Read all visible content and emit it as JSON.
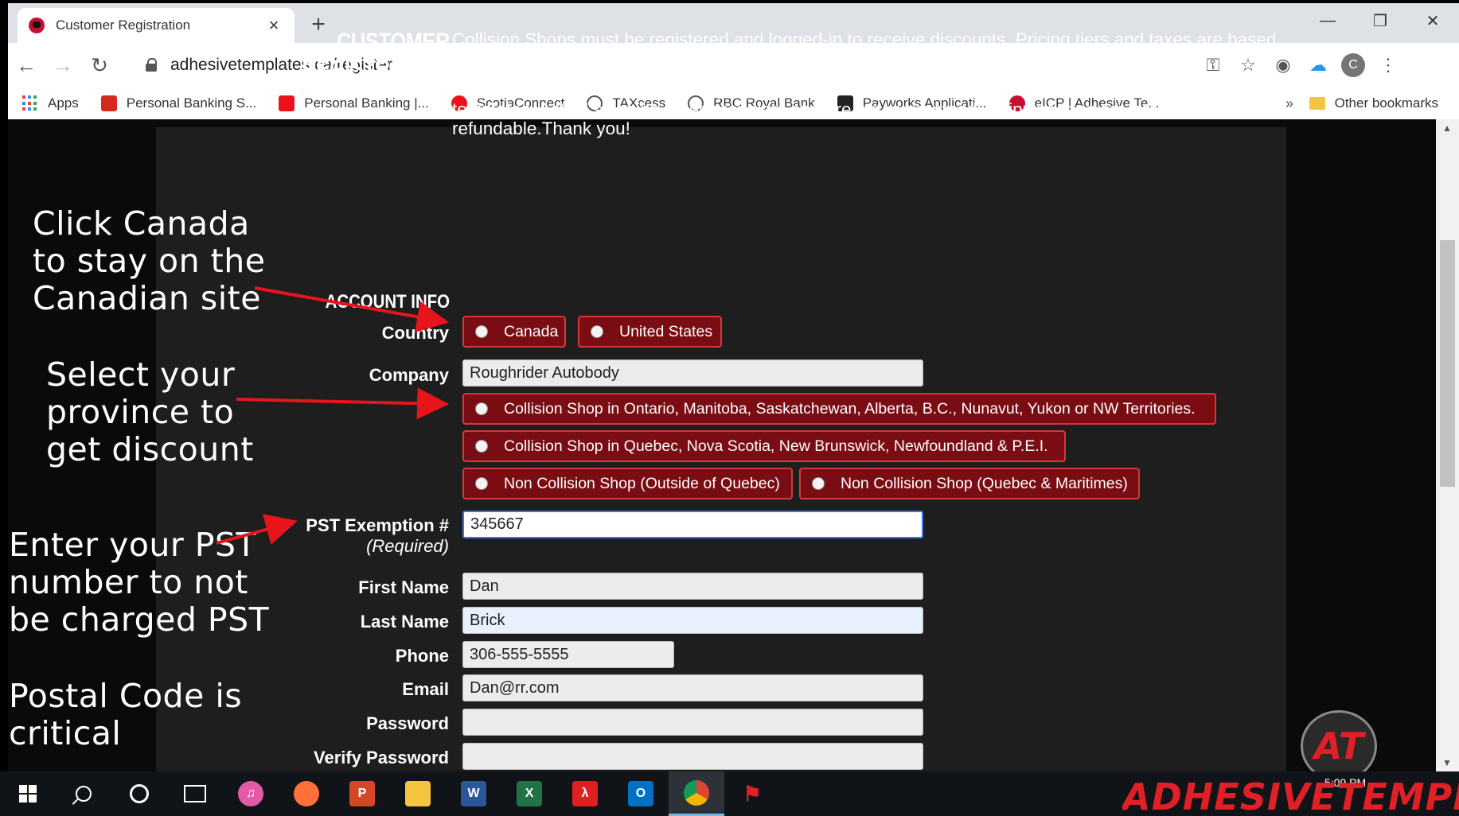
{
  "browser": {
    "tab_title": "Customer Registration",
    "tab_close": "×",
    "new_tab": "+",
    "url": "adhesivetemplates.ca/register",
    "bookmarks": [
      {
        "label": "Apps",
        "icon": "apps-grid-icon"
      },
      {
        "label": "Personal Banking S...",
        "icon": "canada-flag-icon",
        "color": "#d52b1e"
      },
      {
        "label": "Personal Banking |...",
        "icon": "scotiabank-icon",
        "color": "#ec111a"
      },
      {
        "label": "ScotiaConnect",
        "icon": "scotiabank-s-icon",
        "color": "#ec111a"
      },
      {
        "label": "TAXcess",
        "icon": "globe-icon",
        "color": "#555555"
      },
      {
        "label": "RBC Royal Bank",
        "icon": "globe-icon",
        "color": "#555555"
      },
      {
        "label": "Payworks Applicati...",
        "icon": "payworks-icon",
        "color": "#222222"
      },
      {
        "label": "eICP | Adhesive Te...",
        "icon": "adhesive-templates-icon",
        "color": "#c8102e"
      }
    ],
    "more_bookmarks": "»",
    "other_bookmarks": "Other bookmarks",
    "profile_initial": "C"
  },
  "page": {
    "title": "CUSTOMER REGISTRATION",
    "intro_1": "Collision Shops must be registered and logged-in to receive discounts. Pricing tiers and taxes are based on province. Please double-check your email address and province for accuracy.",
    "intro_2": "Supply items will be charged shipping costs based on weight. Express shipping options apply only to templates.  Actual shipping times may vary and are not guaranteed.  Shipping fees are not refundable.Thank you!",
    "section_account": "ACCOUNT INFO",
    "labels": {
      "country": "Country",
      "company": "Company",
      "pst": "PST Exemption #",
      "pst_required": "(Required)",
      "first_name": "First Name",
      "last_name": "Last Name",
      "phone": "Phone",
      "email": "Email",
      "password": "Password",
      "verify_password": "Verify Password"
    },
    "country_options": [
      "Canada",
      "United States"
    ],
    "province_options": [
      "Collision Shop in Ontario, Manitoba, Saskatchewan, Alberta, B.C., Nunavut, Yukon or NW Territories.",
      "Collision Shop in Quebec, Nova Scotia, New Brunswick, Newfoundland & P.E.I.",
      "Non Collision Shop (Outside of Quebec)",
      "Non Collision Shop (Quebec & Maritimes)"
    ],
    "values": {
      "company": "Roughrider Autobody",
      "pst": "345667",
      "first_name": "Dan",
      "last_name": "Brick",
      "phone": "306-555-5555",
      "email": "Dan@rr.com",
      "password": "",
      "verify_password": ""
    }
  },
  "annotations": {
    "canada": "Click Canada to stay on the Canadian site",
    "province": "Select your province to get discount",
    "pst": "Enter your PST number to not be charged PST",
    "postal": "Postal Code is critical",
    "arrow_color": "#e8141c"
  },
  "brand": {
    "badge": "AT",
    "wordmark": "ADHESIVETEMPLATES",
    "clock_partial": "5:09 PM"
  },
  "colors": {
    "radio_bg": "#7a0d14",
    "radio_border": "#d23a3a",
    "brand_red": "#e01f26"
  }
}
